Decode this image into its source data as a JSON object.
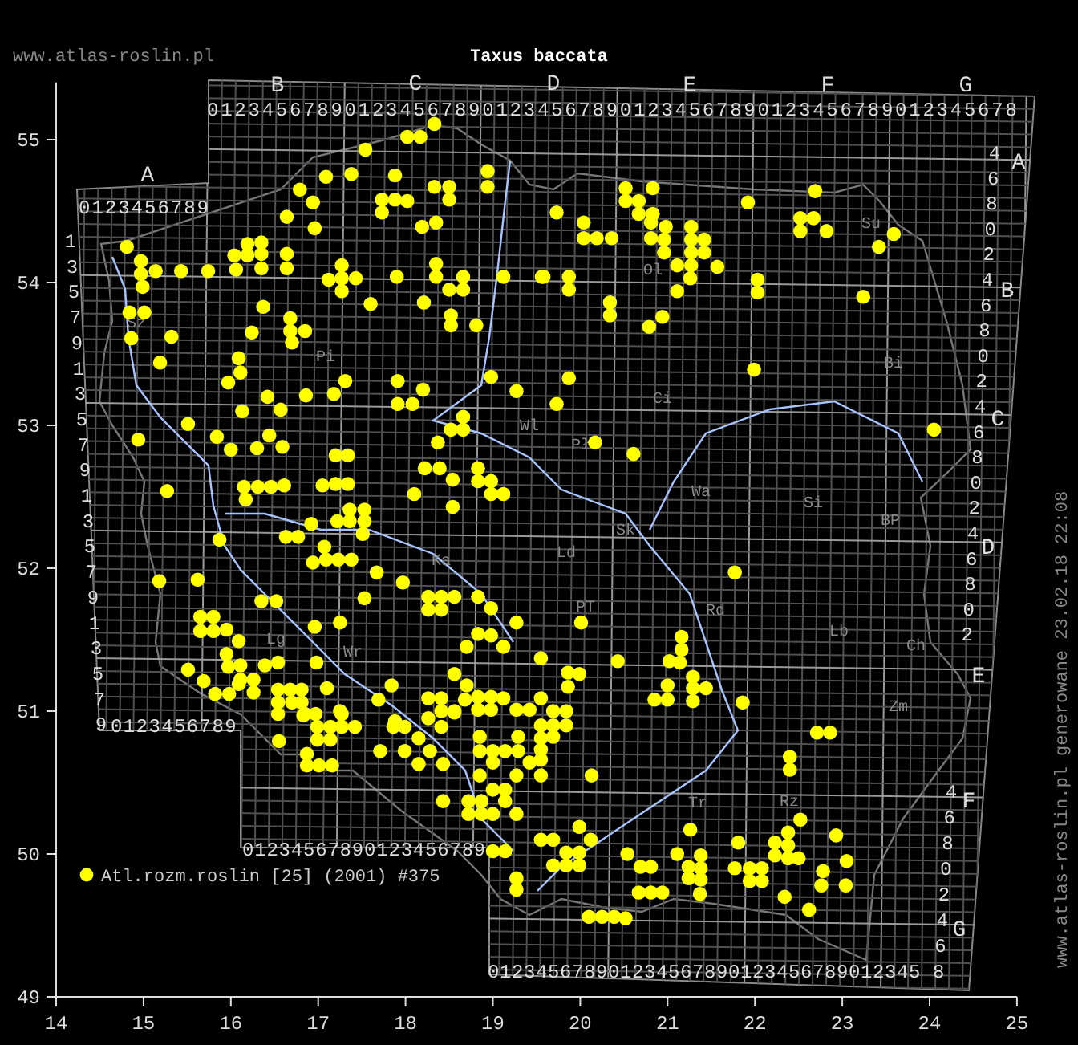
{
  "header": {
    "site": "www.atlas-roslin.pl"
  },
  "map": {
    "column_letters": [
      "A",
      "B",
      "C",
      "D",
      "E",
      "F",
      "G"
    ],
    "row_letters": [
      "A",
      "B",
      "C",
      "D",
      "E",
      "F",
      "G"
    ],
    "top_digits_a": "0123456789",
    "top_digits": "01234567890123456789012345678901234567890123456789012345678",
    "left_digits": [
      "1",
      "3",
      "5",
      "7",
      "9",
      "1",
      "3",
      "5",
      "7",
      "9",
      "1",
      "3",
      "5",
      "7",
      "9",
      "1",
      "3",
      "5",
      "7",
      "9"
    ],
    "right_digits_1": [
      "4",
      "6",
      "8",
      "0",
      "2",
      "4",
      "6",
      "8",
      "0",
      "2",
      "4",
      "6",
      "8",
      "0",
      "2",
      "4",
      "6",
      "8",
      "0",
      "2"
    ],
    "right_digits_2": [
      "4",
      "6",
      "8",
      "0",
      "2",
      "4",
      "6",
      "8"
    ],
    "bottom_digits_a": "0123456789",
    "bottom_digits_1": "01234567890123456789",
    "bottom_digits_2": "012345678901234567890123456789012345",
    "regions": [
      "Ol",
      "Su",
      "Sz",
      "Pi",
      "Bi",
      "Ci",
      "Wl",
      "Pł",
      "Wa",
      "Si",
      "BP",
      "Sk",
      "Ld",
      "Ka",
      "PT",
      "Rd",
      "Lb",
      "Ch",
      "Zm",
      "Lg",
      "Wr",
      "Tr",
      "Rz"
    ],
    "chart_data": {
      "type": "scatter",
      "title": "Taxus baccata",
      "xlim": [
        14,
        25
      ],
      "ylim": [
        49,
        55.4
      ],
      "xticks": [
        {
          "value": 14,
          "label": "14"
        },
        {
          "value": 15,
          "label": "15"
        },
        {
          "value": 16,
          "label": "16"
        },
        {
          "value": 17,
          "label": "17"
        },
        {
          "value": 18,
          "label": "18"
        },
        {
          "value": 19,
          "label": "19"
        },
        {
          "value": 20,
          "label": "20"
        },
        {
          "value": 21,
          "label": "21"
        },
        {
          "value": 22,
          "label": "22"
        },
        {
          "value": 23,
          "label": "23"
        },
        {
          "value": 24,
          "label": "24"
        },
        {
          "value": 25,
          "label": "25"
        }
      ],
      "yticks": [
        {
          "value": 49,
          "label": "49"
        },
        {
          "value": 50,
          "label": "50"
        },
        {
          "value": 51,
          "label": "51"
        },
        {
          "value": 52,
          "label": "52"
        },
        {
          "value": 53,
          "label": "53"
        },
        {
          "value": 54,
          "label": "54"
        },
        {
          "value": 55,
          "label": "55"
        }
      ],
      "x": [
        18.33,
        18.02,
        18.17,
        17.54,
        17.09,
        17.38,
        17.88,
        18.94,
        18.94,
        16.79,
        18.33,
        18.5,
        18.5,
        16.94,
        17.73,
        17.88,
        18.02,
        17.73,
        16.64,
        16.96,
        18.19,
        18.35,
        14.81,
        14.97,
        14.97,
        14.99,
        15.14,
        15.43,
        15.74,
        16.04,
        16.06,
        16.19,
        16.19,
        16.35,
        16.35,
        16.35,
        16.64,
        16.64,
        17.12,
        17.27,
        17.27,
        17.43,
        17.27,
        17.9,
        18.35,
        18.35,
        18.66,
        18.5,
        18.66,
        19.12,
        19.56,
        17.6,
        18.21,
        18.52,
        18.52,
        18.81,
        14.84,
        15.01,
        14.86,
        15.32,
        16.37,
        16.68,
        16.68,
        16.85,
        16.7,
        16.24,
        16.09,
        16.11,
        15.19,
        15.97,
        17.31,
        17.91,
        18.98,
        19.73,
        20.52,
        20.83,
        20.52,
        20.67,
        20.67,
        20.83,
        20.04,
        20.04,
        20.19,
        20.36,
        20.81,
        20.81,
        20.98,
        20.96,
        20.96,
        21.27,
        21.27,
        21.27,
        21.42,
        21.42,
        21.11,
        21.27,
        21.57,
        21.26,
        21.11,
        19.58,
        19.87,
        19.87,
        20.34,
        20.34,
        20.94,
        20.79,
        21.92,
        22.69,
        22.52,
        22.67,
        22.52,
        22.82,
        22.03,
        22.03,
        23.59,
        23.42,
        23.24,
        21.99,
        19.87,
        16.42,
        16.86,
        17.18,
        18.2,
        19.27,
        16.13,
        16.57,
        17.91,
        18.08,
        15.51,
        15.84,
        16.44,
        14.94,
        16.0,
        16.3,
        16.59,
        17.2,
        17.34,
        18.37,
        18.52,
        18.66,
        18.66,
        18.22,
        18.39,
        18.83,
        18.83,
        18.98,
        18.98,
        19.12,
        18.54,
        18.54,
        18.1,
        15.27,
        16.15,
        16.31,
        16.46,
        16.61,
        16.17,
        17.05,
        17.2,
        17.34,
        17.36,
        17.53,
        17.22,
        17.36,
        17.53,
        17.51,
        16.92,
        16.63,
        16.77,
        15.87,
        17.07,
        16.94,
        17.09,
        17.23,
        17.38,
        17.67,
        15.18,
        15.62,
        17.97,
        16.35,
        16.52,
        17.53,
        18.26,
        18.41,
        18.26,
        18.41,
        18.56,
        18.83,
        18.98,
        15.65,
        15.8,
        15.65,
        15.8,
        15.95,
        16.96,
        17.25,
        18.83,
        18.98,
        19.27,
        16.09,
        18.7,
        19.12,
        15.95,
        19.55,
        15.97,
        16.11,
        16.11,
        16.26,
        16.26,
        16.39,
        16.54,
        16.98,
        15.51,
        15.69,
        15.82,
        15.98,
        16.09,
        18.56,
        18.7,
        17.1,
        17.84,
        16.68,
        16.81,
        16.54,
        16.81,
        16.54,
        16.7,
        16.83,
        17.69,
        18.26,
        18.41,
        18.41,
        18.56,
        18.68,
        18.83,
        18.98,
        19.12,
        18.83,
        18.98,
        19.27,
        19.42,
        19.55,
        17.25,
        17.88,
        16.97,
        19.73,
        20.17,
        20.61,
        24.05,
        21.77,
        20.01,
        20.43,
        21.16,
        21.16,
        21.02,
        21.14,
        19.86,
        19.99,
        19.86,
        21.29,
        21.29,
        21.44,
        21.29,
        21.0,
        20.85,
        21.0,
        21.86,
        19.69,
        19.84,
        16.54,
        16.85,
        16.55,
        16.99,
        17.14,
        16.99,
        17.14,
        17.27,
        17.27,
        17.42,
        16.87,
        16.87,
        17.01,
        17.16,
        17.86,
        17.99,
        17.71,
        17.99,
        18.15,
        18.15,
        18.28,
        18.43,
        18.43,
        18.26,
        18.41,
        18.56,
        18.85,
        18.85,
        19.0,
        19.14,
        19.29,
        19.29,
        19.0,
        18.85,
        19.27,
        19.42,
        19.55,
        19.55,
        19.55,
        18.72,
        18.87,
        19.0,
        19.14,
        19.14,
        18.72,
        18.87,
        19.0,
        19.27,
        19.0,
        19.14,
        19.27,
        19.27,
        19.69,
        19.84,
        19.55,
        19.69,
        19.55,
        20.13,
        22.71,
        22.86,
        22.4,
        22.4,
        19.99,
        20.12,
        19.99,
        19.84,
        19.84,
        19.99,
        19.69,
        19.69,
        19.55,
        20.54,
        20.69,
        20.81,
        21.11,
        21.38,
        21.38,
        21.24,
        21.24,
        21.38,
        21.37,
        21.26,
        20.67,
        20.81,
        20.94,
        20.1,
        20.25,
        20.39,
        20.52,
        21.81,
        21.77,
        21.94,
        21.94,
        22.08,
        22.08,
        22.23,
        22.38,
        22.38,
        22.23,
        22.38,
        22.5,
        22.52,
        22.34,
        22.62,
        22.93,
        23.05,
        22.78,
        22.76,
        23.04
      ],
      "series": [
        {
          "name": "Atl.rozm.roslin [25] (2001) #375",
          "color": "#ffff00",
          "values": [
            55.11,
            55.02,
            55.02,
            54.93,
            54.74,
            54.76,
            54.75,
            54.78,
            54.67,
            54.65,
            54.67,
            54.67,
            54.58,
            54.56,
            54.58,
            54.58,
            54.57,
            54.49,
            54.46,
            54.38,
            54.39,
            54.42,
            54.25,
            54.15,
            54.06,
            53.97,
            54.08,
            54.08,
            54.08,
            54.19,
            54.09,
            54.27,
            54.19,
            54.28,
            54.2,
            54.1,
            54.2,
            54.1,
            54.02,
            54.12,
            54.03,
            54.03,
            53.94,
            54.04,
            54.13,
            54.04,
            54.04,
            53.95,
            53.95,
            54.04,
            54.04,
            53.85,
            53.86,
            53.77,
            53.7,
            53.7,
            53.79,
            53.79,
            53.61,
            53.62,
            53.83,
            53.75,
            53.66,
            53.66,
            53.58,
            53.65,
            53.47,
            53.37,
            53.44,
            53.3,
            53.31,
            53.31,
            53.34,
            54.49,
            54.66,
            54.66,
            54.57,
            54.57,
            54.48,
            54.48,
            54.42,
            54.31,
            54.31,
            54.31,
            54.42,
            54.31,
            54.39,
            54.3,
            54.21,
            54.39,
            54.3,
            54.21,
            54.3,
            54.21,
            54.12,
            54.12,
            54.11,
            54.03,
            53.94,
            54.04,
            54.04,
            53.95,
            53.86,
            53.77,
            53.76,
            53.69,
            54.56,
            54.64,
            54.45,
            54.45,
            54.36,
            54.36,
            54.02,
            53.93,
            54.34,
            54.25,
            53.9,
            53.39,
            53.33,
            53.2,
            53.21,
            53.22,
            53.25,
            53.24,
            53.1,
            53.11,
            53.15,
            53.15,
            53.01,
            52.92,
            52.93,
            52.9,
            52.83,
            52.84,
            52.85,
            52.79,
            52.79,
            52.88,
            52.97,
            53.06,
            52.97,
            52.7,
            52.7,
            52.7,
            52.61,
            52.61,
            52.52,
            52.52,
            52.62,
            52.43,
            52.52,
            52.54,
            52.57,
            52.57,
            52.57,
            52.58,
            52.48,
            52.58,
            52.59,
            52.59,
            52.41,
            52.41,
            52.33,
            52.33,
            52.33,
            52.24,
            52.31,
            52.22,
            52.22,
            52.2,
            52.15,
            52.04,
            52.06,
            52.06,
            52.06,
            51.97,
            51.91,
            51.92,
            51.9,
            51.77,
            51.77,
            51.79,
            51.8,
            51.8,
            51.71,
            51.71,
            51.8,
            51.8,
            51.72,
            51.66,
            51.66,
            51.56,
            51.56,
            51.57,
            51.59,
            51.62,
            51.54,
            51.53,
            51.62,
            51.49,
            51.45,
            51.45,
            51.4,
            51.37,
            51.31,
            51.32,
            51.22,
            51.22,
            51.13,
            51.32,
            51.34,
            51.34,
            51.29,
            51.21,
            51.12,
            51.12,
            51.19,
            51.26,
            51.18,
            51.16,
            51.18,
            51.15,
            51.15,
            51.15,
            51.06,
            51.06,
            51.06,
            50.97,
            51.08,
            51.09,
            51.09,
            51.0,
            51.0,
            51.08,
            51.1,
            51.1,
            51.09,
            51.01,
            51.01,
            51.01,
            51.01,
            51.09,
            51.0,
            50.93,
            50.98,
            53.15,
            52.88,
            52.8,
            52.97,
            51.97,
            51.62,
            51.35,
            51.52,
            51.43,
            51.35,
            51.34,
            51.27,
            51.26,
            51.17,
            51.24,
            51.16,
            51.16,
            51.07,
            51.18,
            51.08,
            51.08,
            51.06,
            51.0,
            51.0,
            50.98,
            50.98,
            50.79,
            50.89,
            50.89,
            50.8,
            50.8,
            50.98,
            50.89,
            50.89,
            50.7,
            50.62,
            50.62,
            50.62,
            50.89,
            50.89,
            50.72,
            50.72,
            50.81,
            50.63,
            50.72,
            50.63,
            50.37,
            50.95,
            50.89,
            50.99,
            50.82,
            50.72,
            50.72,
            50.72,
            50.72,
            50.82,
            50.64,
            50.55,
            50.55,
            50.64,
            50.81,
            50.66,
            50.55,
            50.37,
            50.37,
            50.45,
            50.45,
            50.37,
            50.28,
            50.28,
            50.28,
            50.28,
            50.02,
            50.02,
            49.83,
            49.75,
            50.9,
            50.9,
            50.9,
            50.82,
            50.73,
            50.55,
            50.85,
            50.85,
            50.68,
            50.59,
            50.19,
            50.1,
            50.01,
            50.01,
            49.92,
            49.92,
            49.92,
            50.1,
            50.1,
            50.0,
            49.91,
            49.91,
            50.0,
            49.99,
            49.9,
            49.91,
            49.83,
            49.82,
            49.72,
            50.17,
            49.73,
            49.73,
            49.73,
            49.56,
            49.56,
            49.56,
            49.55,
            50.08,
            49.9,
            49.9,
            49.81,
            49.9,
            49.81,
            50.08,
            50.15,
            50.06,
            49.99,
            49.97,
            49.97,
            50.24,
            49.7,
            49.61,
            50.13,
            49.95,
            49.88,
            49.78,
            49.78
          ]
        }
      ]
    }
  },
  "footer": {
    "text": "www.atlas-roslin.pl generowane 23.02.18 22:08"
  }
}
